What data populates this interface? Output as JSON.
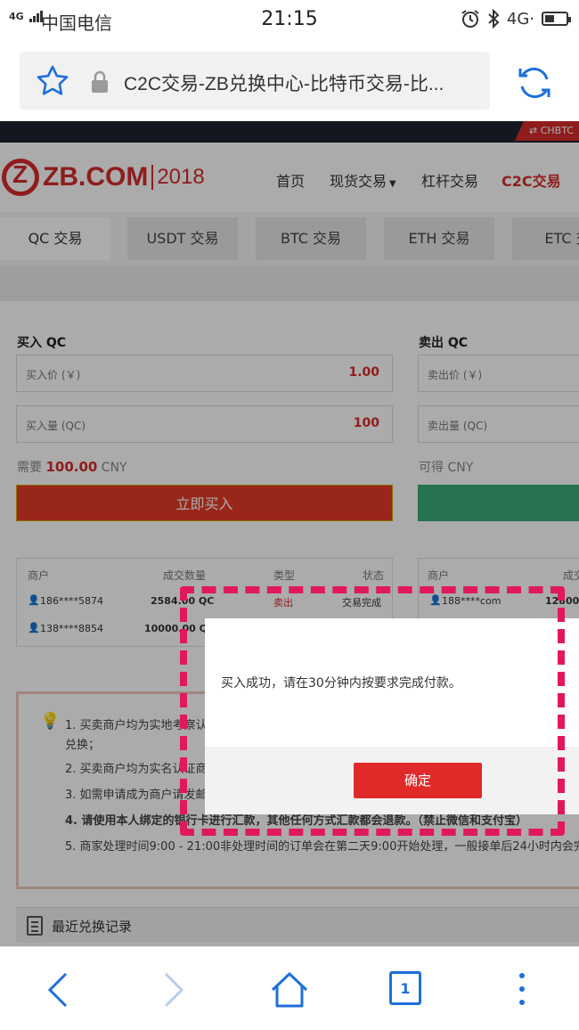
{
  "status_bar": {
    "network": "4G",
    "carrier": "中国电信",
    "time": "21:15",
    "right_network": "4G·",
    "icons": [
      "alarm-icon",
      "bluetooth-icon",
      "battery-charging-icon"
    ]
  },
  "browser": {
    "url_title": "C2C交易-ZB兑换中心-比特币交易-比...",
    "tab_count": "1"
  },
  "site": {
    "badge": "CHBTC",
    "logo_text": "ZB.COM",
    "logo_year": "2018",
    "nav": [
      {
        "label": "首页",
        "active": false
      },
      {
        "label": "现货交易",
        "active": false,
        "has_caret": true
      },
      {
        "label": "杠杆交易",
        "active": false
      },
      {
        "label": "C2C交易",
        "active": true
      }
    ],
    "tabs": [
      "QC 交易",
      "USDT 交易",
      "BTC 交易",
      "ETH 交易",
      "ETC 交"
    ],
    "active_tab": 0
  },
  "buy": {
    "title": "买入 QC",
    "price_label": "买入价 (￥)",
    "price_value": "1.00",
    "amount_label": "买入量 (QC)",
    "amount_value": "100",
    "need_prefix": "需要",
    "need_amount": "100.00",
    "need_unit": "CNY",
    "button": "立即买入"
  },
  "sell": {
    "title": "卖出 QC",
    "price_label": "卖出价 (￥)",
    "amount_label": "卖出量 (QC)",
    "get_text": "可得 CNY"
  },
  "buy_table": {
    "headers": [
      "商户",
      "成交数量",
      "类型",
      "状态"
    ],
    "rows": [
      {
        "merchant": "186****5874",
        "amount": "2584.00 QC",
        "type": "卖出",
        "status": "交易完成"
      },
      {
        "merchant": "138****8854",
        "amount": "10000.00 QC",
        "type": "",
        "status": ""
      }
    ]
  },
  "sell_table": {
    "headers": [
      "商户",
      "成交"
    ],
    "rows": [
      {
        "merchant": "188****com",
        "amount": "12800.0"
      }
    ]
  },
  "notice": {
    "items": [
      "1. 买卖商户均为实地考察认",
      "兑换；",
      "2. 买卖商户均为实名认证商",
      "3. 如需申请成为商户请发邮",
      "4. 请使用本人绑定的银行卡进行汇款，其他任何方式汇款都会退款。（禁止微信和支付宝）",
      "5. 商家处理时间9:00 - 21:00非处理时间的订单会在第二天9:00开始处理，一般接单后24小时内会完"
    ]
  },
  "recent": {
    "title": "最近兑换记录"
  },
  "dialog": {
    "message": "买入成功，请在30分钟内按要求完成付款。",
    "ok_button": "确定"
  },
  "colors": {
    "brand_red": "#d62c2c",
    "buy_button": "#e53b26",
    "sell_button": "#3aaa7a",
    "highlight_dash": "#e0195a",
    "browser_blue": "#1e6fd9"
  }
}
